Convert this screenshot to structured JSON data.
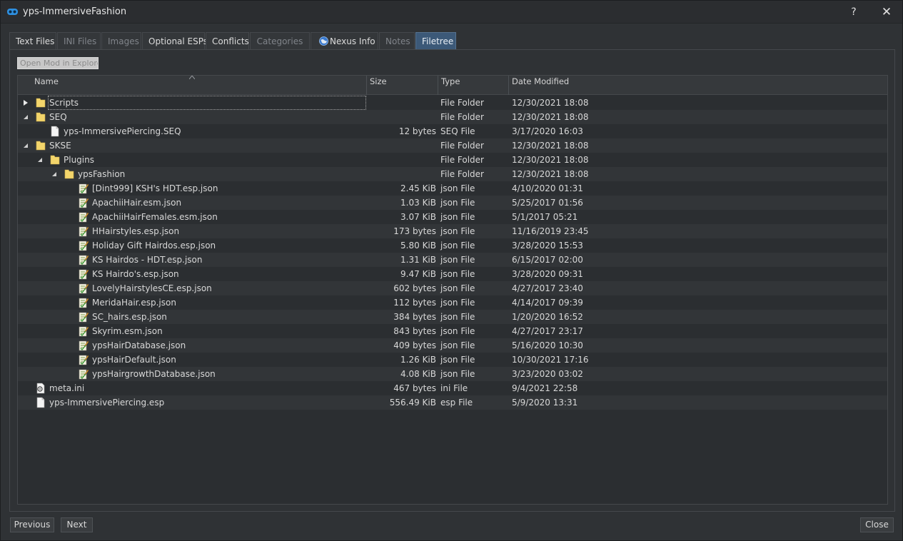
{
  "window": {
    "title": "yps-ImmersiveFashion",
    "help": "?",
    "close_glyph": "✕"
  },
  "tabs": [
    {
      "label": "Text Files",
      "state": "normal"
    },
    {
      "label": "INI Files",
      "state": "disabled"
    },
    {
      "label": "Images",
      "state": "disabled"
    },
    {
      "label": "Optional ESPs",
      "state": "normal"
    },
    {
      "label": "Conflicts",
      "state": "normal"
    },
    {
      "label": "Categories",
      "state": "disabled"
    },
    {
      "label": "Nexus Info",
      "state": "normal",
      "icon": "globe-icon"
    },
    {
      "label": "Notes",
      "state": "disabled"
    },
    {
      "label": "Filetree",
      "state": "active"
    }
  ],
  "toolbar": {
    "open_in_explorer": "Open Mod in Explorer"
  },
  "columns": {
    "name": "Name",
    "size": "Size",
    "type": "Type",
    "date": "Date Modified"
  },
  "rows": [
    {
      "name": "Scripts",
      "size": "",
      "type": "File Folder",
      "date": "12/30/2021 18:08",
      "depth": 0,
      "icon": "folder-icon",
      "expander": "collapsed",
      "focused": true
    },
    {
      "name": "SEQ",
      "size": "",
      "type": "File Folder",
      "date": "12/30/2021 18:08",
      "depth": 0,
      "icon": "folder-icon",
      "expander": "expanded"
    },
    {
      "name": "yps-ImmersivePiercing.SEQ",
      "size": "12 bytes",
      "type": "SEQ File",
      "date": "3/17/2020 16:03",
      "depth": 1,
      "icon": "file-icon"
    },
    {
      "name": "SKSE",
      "size": "",
      "type": "File Folder",
      "date": "12/30/2021 18:08",
      "depth": 0,
      "icon": "folder-icon",
      "expander": "expanded"
    },
    {
      "name": "Plugins",
      "size": "",
      "type": "File Folder",
      "date": "12/30/2021 18:08",
      "depth": 1,
      "icon": "folder-icon",
      "expander": "expanded"
    },
    {
      "name": "ypsFashion",
      "size": "",
      "type": "File Folder",
      "date": "12/30/2021 18:08",
      "depth": 2,
      "icon": "folder-icon",
      "expander": "expanded"
    },
    {
      "name": "[Dint999] KSH's HDT.esp.json",
      "size": "2.45 KiB",
      "type": "json File",
      "date": "4/10/2020 01:31",
      "depth": 3,
      "icon": "json-file-icon"
    },
    {
      "name": "ApachiiHair.esm.json",
      "size": "1.03 KiB",
      "type": "json File",
      "date": "5/25/2017 01:56",
      "depth": 3,
      "icon": "json-file-icon"
    },
    {
      "name": "ApachiiHairFemales.esm.json",
      "size": "3.07 KiB",
      "type": "json File",
      "date": "5/1/2017 05:21",
      "depth": 3,
      "icon": "json-file-icon"
    },
    {
      "name": "HHairstyles.esp.json",
      "size": "173 bytes",
      "type": "json File",
      "date": "11/16/2019 23:45",
      "depth": 3,
      "icon": "json-file-icon"
    },
    {
      "name": "Holiday Gift Hairdos.esp.json",
      "size": "5.80 KiB",
      "type": "json File",
      "date": "3/28/2020 15:53",
      "depth": 3,
      "icon": "json-file-icon"
    },
    {
      "name": "KS Hairdos - HDT.esp.json",
      "size": "1.31 KiB",
      "type": "json File",
      "date": "6/15/2017 02:00",
      "depth": 3,
      "icon": "json-file-icon"
    },
    {
      "name": "KS Hairdo's.esp.json",
      "size": "9.47 KiB",
      "type": "json File",
      "date": "3/28/2020 09:31",
      "depth": 3,
      "icon": "json-file-icon"
    },
    {
      "name": "LovelyHairstylesCE.esp.json",
      "size": "602 bytes",
      "type": "json File",
      "date": "4/27/2017 23:40",
      "depth": 3,
      "icon": "json-file-icon"
    },
    {
      "name": "MeridaHair.esp.json",
      "size": "112 bytes",
      "type": "json File",
      "date": "4/14/2017 09:39",
      "depth": 3,
      "icon": "json-file-icon"
    },
    {
      "name": "SC_hairs.esp.json",
      "size": "384 bytes",
      "type": "json File",
      "date": "1/20/2020 16:52",
      "depth": 3,
      "icon": "json-file-icon"
    },
    {
      "name": "Skyrim.esm.json",
      "size": "843 bytes",
      "type": "json File",
      "date": "4/27/2017 23:17",
      "depth": 3,
      "icon": "json-file-icon"
    },
    {
      "name": "ypsHairDatabase.json",
      "size": "409 bytes",
      "type": "json File",
      "date": "5/16/2020 10:30",
      "depth": 3,
      "icon": "json-file-icon"
    },
    {
      "name": "ypsHairDefault.json",
      "size": "1.26 KiB",
      "type": "json File",
      "date": "10/30/2021 17:16",
      "depth": 3,
      "icon": "json-file-icon"
    },
    {
      "name": "ypsHairgrowthDatabase.json",
      "size": "4.08 KiB",
      "type": "json File",
      "date": "3/23/2020 03:02",
      "depth": 3,
      "icon": "json-file-icon"
    },
    {
      "name": "meta.ini",
      "size": "467 bytes",
      "type": "ini File",
      "date": "9/4/2021 22:58",
      "depth": 0,
      "icon": "settings-file-icon"
    },
    {
      "name": "yps-ImmersivePiercing.esp",
      "size": "556.49 KiB",
      "type": "esp File",
      "date": "5/9/2020 13:31",
      "depth": 0,
      "icon": "file-icon"
    }
  ],
  "footer": {
    "previous": "Previous",
    "next": "Next",
    "close": "Close"
  },
  "colors": {
    "active_tab": "#3c5978",
    "folder": "#f3d56b",
    "window_bg": "#2f3235"
  }
}
